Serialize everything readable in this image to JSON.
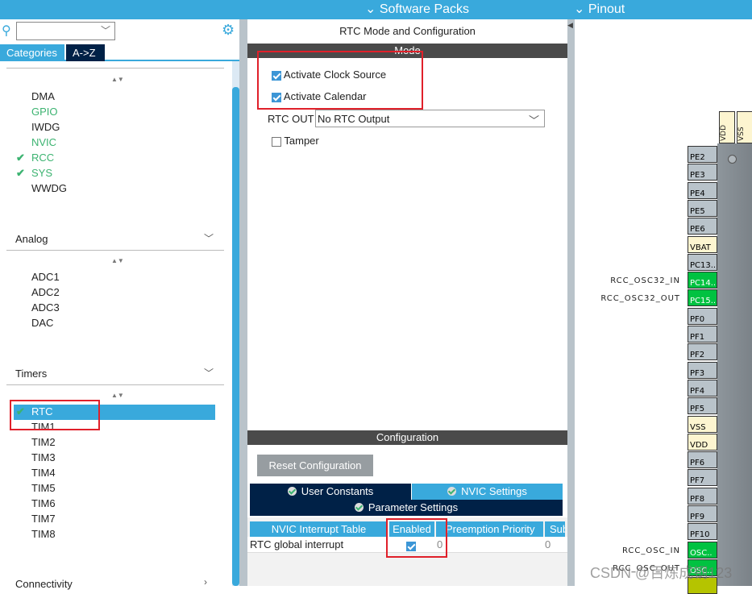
{
  "topbar": {
    "software_packs": "Software Packs",
    "pinout": "Pinout"
  },
  "left": {
    "search": {
      "value": "",
      "placeholder": ""
    },
    "tabs": {
      "categories": "Categories",
      "az": "A->Z"
    },
    "system_items": [
      {
        "label": "DMA",
        "state": "normal"
      },
      {
        "label": "GPIO",
        "state": "green"
      },
      {
        "label": "IWDG",
        "state": "normal"
      },
      {
        "label": "NVIC",
        "state": "green"
      },
      {
        "label": "RCC",
        "state": "checked"
      },
      {
        "label": "SYS",
        "state": "checked"
      },
      {
        "label": "WWDG",
        "state": "normal"
      }
    ],
    "analog": {
      "title": "Analog",
      "items": [
        "ADC1",
        "ADC2",
        "ADC3",
        "DAC"
      ]
    },
    "timers": {
      "title": "Timers",
      "items": [
        "RTC",
        "TIM1",
        "TIM2",
        "TIM3",
        "TIM4",
        "TIM5",
        "TIM6",
        "TIM7",
        "TIM8"
      ],
      "selected": "RTC"
    },
    "connectivity": {
      "title": "Connectivity"
    }
  },
  "mode": {
    "title": "RTC Mode and Configuration",
    "section": "Mode",
    "activate_clock_source": {
      "label": "Activate Clock Source",
      "checked": true
    },
    "activate_calendar": {
      "label": "Activate Calendar",
      "checked": true
    },
    "rtc_out": {
      "label": "RTC OUT",
      "value": "No RTC Output"
    },
    "tamper": {
      "label": "Tamper",
      "checked": false
    }
  },
  "config": {
    "section": "Configuration",
    "reset": "Reset Configuration",
    "tabs": [
      "User Constants",
      "NVIC Settings",
      "Parameter Settings"
    ],
    "active_tab": "NVIC Settings",
    "table": {
      "headers": [
        "NVIC Interrupt Table",
        "Enabled",
        "Preemption Priority",
        "Sub Priority"
      ],
      "rows": [
        {
          "name": "RTC global interrupt",
          "enabled": true,
          "preemption": "0",
          "sub": "0"
        }
      ]
    }
  },
  "pinout": {
    "top_pins": [
      "VDD",
      "VSS"
    ],
    "pins": [
      {
        "n": "PE2",
        "t": "n"
      },
      {
        "n": "PE3",
        "t": "n"
      },
      {
        "n": "PE4",
        "t": "n"
      },
      {
        "n": "PE5",
        "t": "n"
      },
      {
        "n": "PE6",
        "t": "n"
      },
      {
        "n": "VBAT",
        "t": "pw"
      },
      {
        "n": "PC13..",
        "t": "n"
      },
      {
        "n": "PC14..",
        "t": "gr",
        "l": "RCC_OSC32_IN"
      },
      {
        "n": "PC15..",
        "t": "gr",
        "l": "RCC_OSC32_OUT"
      },
      {
        "n": "PF0",
        "t": "n"
      },
      {
        "n": "PF1",
        "t": "n"
      },
      {
        "n": "PF2",
        "t": "n"
      },
      {
        "n": "PF3",
        "t": "n"
      },
      {
        "n": "PF4",
        "t": "n"
      },
      {
        "n": "PF5",
        "t": "n"
      },
      {
        "n": "VSS",
        "t": "pw"
      },
      {
        "n": "VDD",
        "t": "pw"
      },
      {
        "n": "PF6",
        "t": "n"
      },
      {
        "n": "PF7",
        "t": "n"
      },
      {
        "n": "PF8",
        "t": "n"
      },
      {
        "n": "PF9",
        "t": "n"
      },
      {
        "n": "PF10",
        "t": "n"
      },
      {
        "n": "OSC..",
        "t": "gr",
        "l": "RCC_OSC_IN"
      },
      {
        "n": "OSC..",
        "t": "gr",
        "l": "RCC_OSC_OUT"
      },
      {
        "n": "",
        "t": "yg"
      }
    ]
  },
  "watermark": "CSDN @百炼成钢123",
  "colors": {
    "accent": "#39a9dc",
    "navy": "#002147",
    "green": "#00c241",
    "highlight": "#e0202a"
  }
}
